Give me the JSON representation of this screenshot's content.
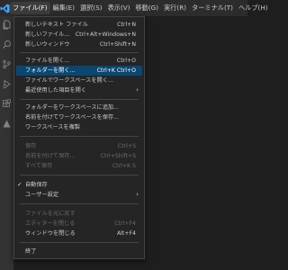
{
  "menubar": {
    "items": [
      "ファイル(F)",
      "編集(E)",
      "選択(S)",
      "表示(V)",
      "移動(G)",
      "実行(R)",
      "ターミナル(T)",
      "ヘルプ(H)"
    ]
  },
  "activitybar": {
    "icons": [
      "files-icon",
      "search-icon",
      "source-control-icon",
      "run-debug-icon",
      "extensions-icon",
      "remote-icon"
    ]
  },
  "file_menu": {
    "items": [
      {
        "label": "新しいテキスト ファイル",
        "shortcut": "Ctrl+N"
      },
      {
        "label": "新しいファイル...",
        "shortcut": "Ctrl+Alt+Windows+N"
      },
      {
        "label": "新しいウィンドウ",
        "shortcut": "Ctrl+Shift+N"
      },
      {
        "label": "ファイルを開く...",
        "shortcut": "Ctrl+O"
      },
      {
        "label": "フォルダーを開く...",
        "shortcut": "Ctrl+K Ctrl+O"
      },
      {
        "label": "ファイルでワークスペースを開く...",
        "shortcut": ""
      },
      {
        "label": "最近使用した項目を開く",
        "shortcut": ""
      },
      {
        "label": "フォルダーをワークスペースに追加...",
        "shortcut": ""
      },
      {
        "label": "名前を付けてワークスペースを保存...",
        "shortcut": ""
      },
      {
        "label": "ワークスペースを複製",
        "shortcut": ""
      },
      {
        "label": "保存",
        "shortcut": "Ctrl+S"
      },
      {
        "label": "名前を付けて保存...",
        "shortcut": "Ctrl+Shift+S"
      },
      {
        "label": "すべて保存",
        "shortcut": "Ctrl+K S"
      },
      {
        "label": "自動保存",
        "shortcut": ""
      },
      {
        "label": "ユーザー設定",
        "shortcut": ""
      },
      {
        "label": "ファイルを元に戻す",
        "shortcut": ""
      },
      {
        "label": "エディターを閉じる",
        "shortcut": "Ctrl+F4"
      },
      {
        "label": "ウィンドウを閉じる",
        "shortcut": "Alt+F4"
      },
      {
        "label": "終了",
        "shortcut": ""
      }
    ]
  },
  "colors": {
    "highlight": "#094771",
    "menu_bg": "#252526",
    "disabled_text": "#6b6b6b",
    "logo_blue": "#3ea6ff"
  }
}
